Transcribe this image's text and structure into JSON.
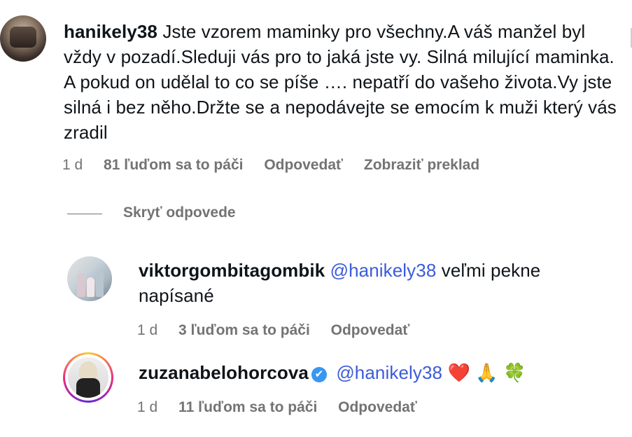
{
  "comments": [
    {
      "username": "hanikely38",
      "text": "Jste vzorem maminky pro všechny.A váš manžel byl vždy v pozadí.Sleduji vás pro to jaká jste vy. Silná milující maminka. A pokud on udělal to co se píše …. nepatří do vašeho života.Vy jste silná i bez něho.Držte se a nepodávejte se emocím k muži který vás zradil",
      "time": "1 d",
      "likes": "81 ľuďom sa to páči",
      "reply_label": "Odpovedať",
      "translate_label": "Zobraziť preklad"
    }
  ],
  "replies_toggle": "Skryť odpovede",
  "replies": [
    {
      "username": "viktorgombitagombik",
      "mention": "@hanikely38",
      "text_line1": "veľmi pekne",
      "text_line2": "napísané",
      "time": "1 d",
      "likes": "3 ľuďom sa to páči",
      "reply_label": "Odpovedať"
    },
    {
      "username": "zuzanabelohorcova",
      "verified_icon": "✔",
      "mention": "@hanikely38",
      "emoji_heart": "❤️",
      "emoji_pray": "🙏",
      "emoji_clover": "🍀",
      "time": "1 d",
      "likes": "11 ľuďom sa to páči",
      "reply_label": "Odpovedať"
    }
  ],
  "colors": {
    "mention": "#3b5bdb",
    "meta": "#737373",
    "verified": "#3897f0"
  }
}
